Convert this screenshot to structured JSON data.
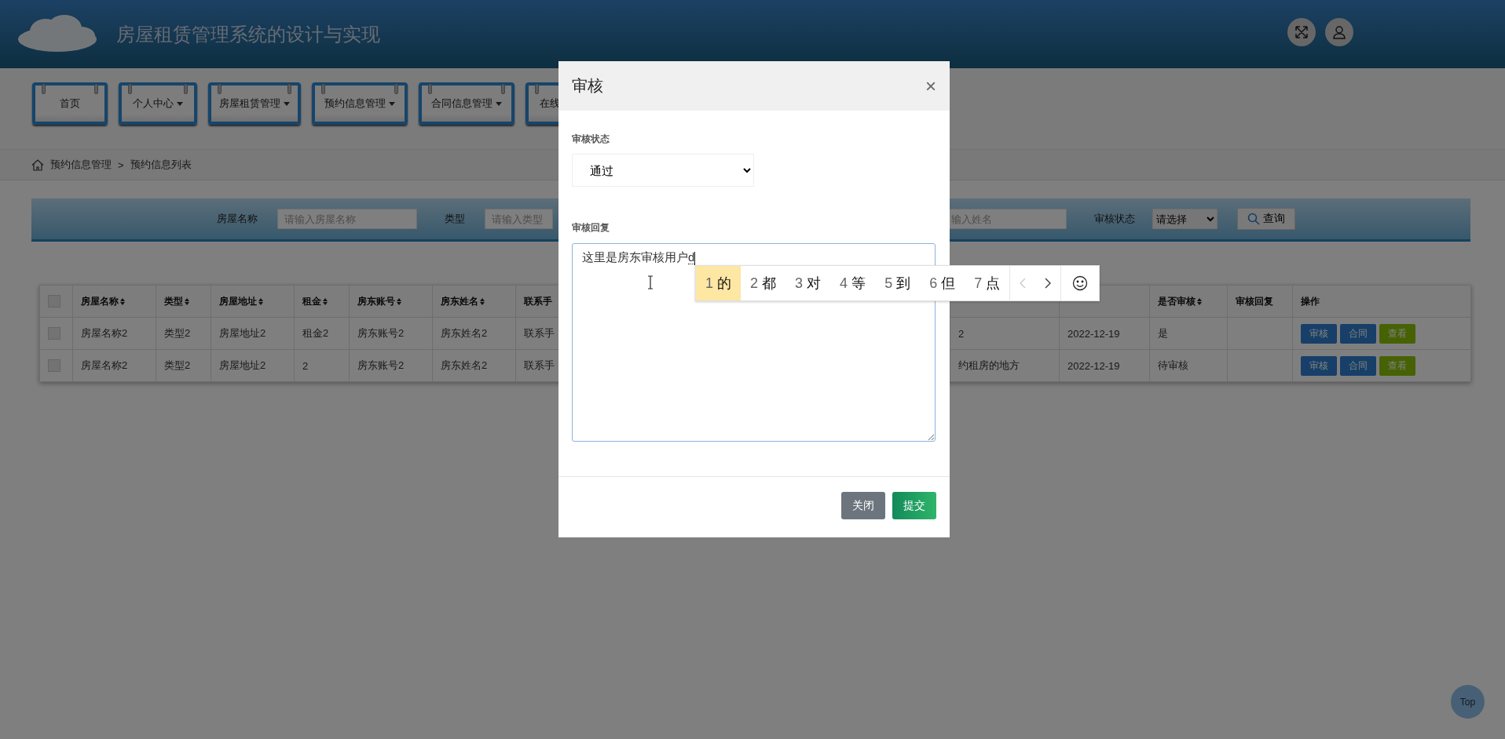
{
  "header": {
    "title": "房屋租赁管理系统的设计与实现"
  },
  "nav": [
    {
      "label": "首页",
      "dropdown": false
    },
    {
      "label": "个人中心",
      "dropdown": true
    },
    {
      "label": "房屋租赁管理",
      "dropdown": true
    },
    {
      "label": "预约信息管理",
      "dropdown": true
    },
    {
      "label": "合同信息管理",
      "dropdown": true
    },
    {
      "label": "在线",
      "dropdown": false
    }
  ],
  "breadcrumb": [
    "预约信息管理",
    "预约信息列表"
  ],
  "breadcrumb_separator": ">",
  "search": {
    "name_label": "房屋名称",
    "name_placeholder": "请输入房屋名称",
    "type_label": "类型",
    "type_placeholder": "请输入类型",
    "owner_placeholder": "输入姓名",
    "status_label": "审核状态",
    "status_value": "请选择",
    "query_button": "查询"
  },
  "table": {
    "columns": [
      {
        "label": "房屋名称",
        "sortable": true
      },
      {
        "label": "类型",
        "sortable": true
      },
      {
        "label": "房屋地址",
        "sortable": true
      },
      {
        "label": "租金",
        "sortable": true
      },
      {
        "label": "房东账号",
        "sortable": true
      },
      {
        "label": "房东姓名",
        "sortable": true
      },
      {
        "label": "联系手",
        "sortable": false
      },
      null,
      null,
      {
        "label": "是否审核",
        "sortable": true
      },
      {
        "label": "审核回复",
        "sortable": false
      },
      {
        "label": "操作",
        "sortable": false
      }
    ],
    "header_checked": false,
    "rows": [
      {
        "checked": false,
        "cells": [
          "房屋名称2",
          "类型2",
          "房屋地址2",
          "租金2",
          "房东账号2",
          "房东姓名2",
          "联系手",
          "2",
          "2022-12-19",
          "是",
          ""
        ],
        "actions": [
          {
            "label": "审核",
            "kind": "primary"
          },
          {
            "label": "合同",
            "kind": "primary"
          },
          {
            "label": "查看",
            "kind": "success"
          }
        ]
      },
      {
        "checked": false,
        "cells": [
          "房屋名称2",
          "类型2",
          "房屋地址2",
          "2",
          "房东账号2",
          "房东姓名2",
          "联系手",
          "约租房的地方",
          "2022-12-19",
          "待审核",
          ""
        ],
        "actions": [
          {
            "label": "审核",
            "kind": "primary"
          },
          {
            "label": "合同",
            "kind": "primary"
          },
          {
            "label": "查看",
            "kind": "success"
          }
        ]
      }
    ]
  },
  "modal": {
    "title": "审核",
    "close": "×",
    "status_label": "审核状态",
    "status_value": "通过",
    "reply_label": "审核回复",
    "reply_value": "这里是房东审核用户",
    "reply_composition": "d",
    "buttons": [
      {
        "label": "关闭",
        "kind": "secondary"
      },
      {
        "label": "提交",
        "kind": "success"
      }
    ]
  },
  "ime": {
    "candidates": [
      {
        "index": "1",
        "text": "的",
        "selected": true
      },
      {
        "index": "2",
        "text": "都",
        "selected": false
      },
      {
        "index": "3",
        "text": "对",
        "selected": false
      },
      {
        "index": "4",
        "text": "等",
        "selected": false
      },
      {
        "index": "5",
        "text": "到",
        "selected": false
      },
      {
        "index": "6",
        "text": "但",
        "selected": false
      },
      {
        "index": "7",
        "text": "点",
        "selected": false
      }
    ],
    "prev_disabled": true,
    "next_disabled": false
  },
  "top_button": "Top"
}
